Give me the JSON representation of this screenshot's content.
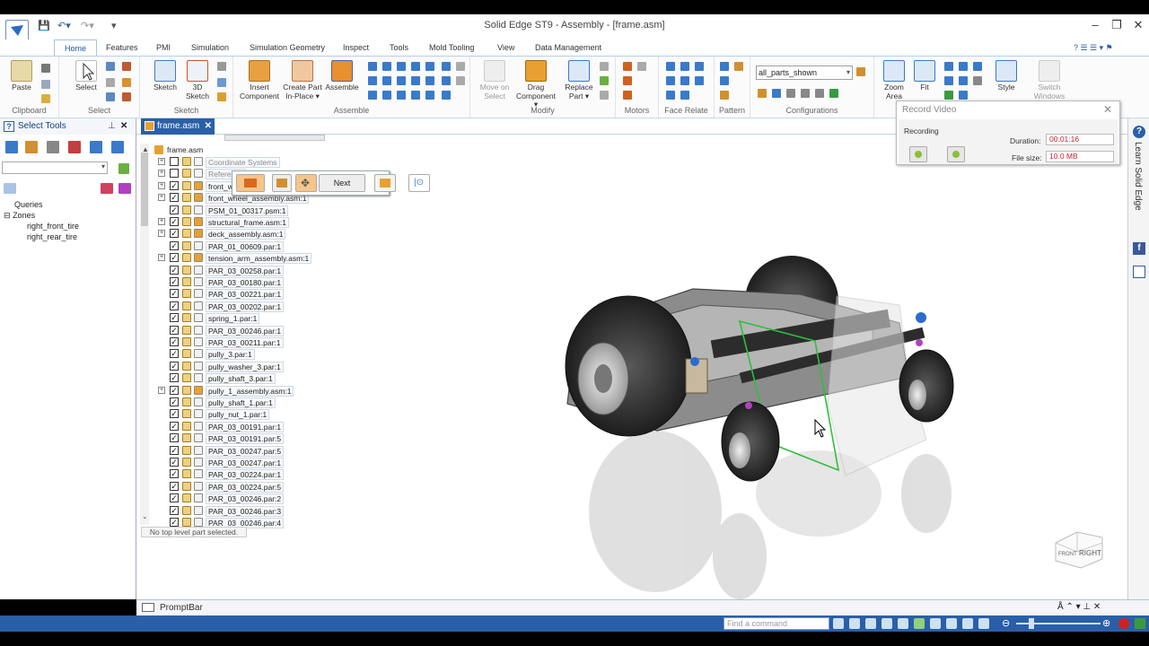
{
  "window": {
    "title": "Solid Edge ST9 - Assembly - [frame.asm]"
  },
  "tabs": [
    "Home",
    "Features",
    "PMI",
    "Simulation",
    "Simulation Geometry",
    "Inspect",
    "Tools",
    "Mold Tooling",
    "View",
    "Data Management"
  ],
  "ribbon": {
    "paste": "Paste",
    "select": "Select",
    "sketch": "Sketch",
    "sketch3d_line1": "3D",
    "sketch3d_line2": "Sketch",
    "insert_line1": "Insert",
    "insert_line2": "Component",
    "create_line1": "Create Part",
    "create_line2": "In-Place",
    "assemble": "Assemble",
    "move_line1": "Move on",
    "move_line2": "Select",
    "drag_line1": "Drag",
    "drag_line2": "Component",
    "replace_line1": "Replace",
    "replace_line2": "Part",
    "configurations_value": "all_parts_shown",
    "zoom_line1": "Zoom",
    "zoom_line2": "Area",
    "fit": "Fit",
    "style": "Style",
    "switch_line1": "Switch",
    "switch_line2": "Windows",
    "groups": {
      "clipboard": "Clipboard",
      "select": "Select",
      "sketch": "Sketch",
      "assemble": "Assemble",
      "modify": "Modify",
      "motors": "Motors",
      "face_relate": "Face Relate",
      "pattern": "Pattern",
      "configurations": "Configurations"
    }
  },
  "select_tools": {
    "title": "Select Tools",
    "tree": {
      "queries": "Queries",
      "zones": "Zones",
      "zone_items": [
        "right_front_tire",
        "right_rear_tire"
      ]
    }
  },
  "document_tab": "frame.asm",
  "pathfinder": {
    "root": "frame.asm",
    "items": [
      {
        "label": "Coordinate Systems",
        "expand": true,
        "checked": false,
        "type": "coord"
      },
      {
        "label": "Reference",
        "expand": true,
        "checked": false,
        "type": "ref"
      },
      {
        "label": "front_w",
        "expand": true,
        "checked": true,
        "type": "asm"
      },
      {
        "label": "front_wheel_assembly.asm:1",
        "expand": true,
        "checked": true,
        "type": "asm"
      },
      {
        "label": "PSM_01_00317.psm:1",
        "expand": false,
        "checked": true,
        "type": "part"
      },
      {
        "label": "structural_frame.asm:1",
        "expand": true,
        "checked": true,
        "type": "asm"
      },
      {
        "label": "deck_assembly.asm:1",
        "expand": true,
        "checked": true,
        "type": "asm"
      },
      {
        "label": "PAR_01_00609.par:1",
        "expand": false,
        "checked": true,
        "type": "part"
      },
      {
        "label": "tension_arm_assembly.asm:1",
        "expand": true,
        "checked": true,
        "type": "asm"
      },
      {
        "label": "PAR_03_00258.par:1",
        "expand": false,
        "checked": true,
        "type": "part"
      },
      {
        "label": "PAR_03_00180.par:1",
        "expand": false,
        "checked": true,
        "type": "part"
      },
      {
        "label": "PAR_03_00221.par:1",
        "expand": false,
        "checked": true,
        "type": "part"
      },
      {
        "label": "PAR_03_00202.par:1",
        "expand": false,
        "checked": true,
        "type": "part"
      },
      {
        "label": "spring_1.par:1",
        "expand": false,
        "checked": true,
        "type": "part"
      },
      {
        "label": "PAR_03_00246.par:1",
        "expand": false,
        "checked": true,
        "type": "part"
      },
      {
        "label": "PAR_03_00211.par:1",
        "expand": false,
        "checked": true,
        "type": "part"
      },
      {
        "label": "pully_3.par:1",
        "expand": false,
        "checked": true,
        "type": "part"
      },
      {
        "label": "pully_washer_3.par:1",
        "expand": false,
        "checked": true,
        "type": "part"
      },
      {
        "label": "pully_shaft_3.par:1",
        "expand": false,
        "checked": true,
        "type": "part"
      },
      {
        "label": "pully_1_assembly.asm:1",
        "expand": true,
        "checked": true,
        "type": "asm"
      },
      {
        "label": "pully_shaft_1.par:1",
        "expand": false,
        "checked": true,
        "type": "part"
      },
      {
        "label": "pully_nut_1.par:1",
        "expand": false,
        "checked": true,
        "type": "part"
      },
      {
        "label": "PAR_03_00191.par:1",
        "expand": false,
        "checked": true,
        "type": "part"
      },
      {
        "label": "PAR_03_00191.par:5",
        "expand": false,
        "checked": true,
        "type": "part"
      },
      {
        "label": "PAR_03_00247.par:5",
        "expand": false,
        "checked": true,
        "type": "part"
      },
      {
        "label": "PAR_03_00247.par:1",
        "expand": false,
        "checked": true,
        "type": "part"
      },
      {
        "label": "PAR_03_00224.par:1",
        "expand": false,
        "checked": true,
        "type": "part"
      },
      {
        "label": "PAR_03_00224.par:5",
        "expand": false,
        "checked": true,
        "type": "part"
      },
      {
        "label": "PAR_03_00246.par:2",
        "expand": false,
        "checked": true,
        "type": "part"
      },
      {
        "label": "PAR_03_00246.par:3",
        "expand": false,
        "checked": true,
        "type": "part"
      },
      {
        "label": "PAR_03_00246.par:4",
        "expand": false,
        "checked": true,
        "type": "part"
      }
    ],
    "status": "No top level part selected."
  },
  "command_bar": {
    "next": "Next"
  },
  "record_video": {
    "title": "Record Video",
    "recording": "Recording",
    "duration_label": "Duration:",
    "duration_value": "00:01:16",
    "filesize_label": "File size:",
    "filesize_value": "10.0 MB"
  },
  "side_panel": {
    "learn": "Learn Solid Edge"
  },
  "viewcube": {
    "front": "FRONT",
    "right": "RIGHT"
  },
  "prompt_bar": "PromptBar",
  "status_bar": {
    "find_placeholder": "Find a command"
  },
  "colors": {
    "accent": "#2a5fa8",
    "status_bar": "#2a5fa8",
    "selection_green": "#2fbf3a"
  }
}
